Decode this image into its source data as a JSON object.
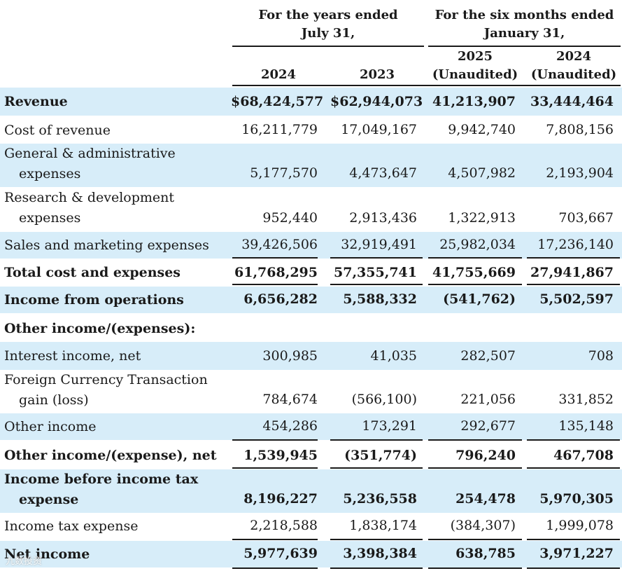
{
  "header": {
    "years_line1": "For the years ended",
    "years_line2": "July 31,",
    "six_line1": "For the six months ended",
    "six_line2": "January 31,",
    "col_2024": "2024",
    "col_2023": "2023",
    "col_2025_year": "2025",
    "col_2025_note": "(Unaudited)",
    "col_2024b_year": "2024",
    "col_2024b_note": "(Unaudited)"
  },
  "rows": [
    {
      "label": "Revenue",
      "v": [
        "$68,424,577",
        "$62,944,073",
        "41,213,907",
        "33,444,464"
      ]
    },
    {
      "label": "Cost of revenue",
      "v": [
        "16,211,779",
        "17,049,167",
        "9,942,740",
        "7,808,156"
      ]
    },
    {
      "label1": "General & administrative",
      "label2": "expenses",
      "v": [
        "5,177,570",
        "4,473,647",
        "4,507,982",
        "2,193,904"
      ]
    },
    {
      "label1": "Research & development",
      "label2": "expenses",
      "v": [
        "952,440",
        "2,913,436",
        "1,322,913",
        "703,667"
      ]
    },
    {
      "label": "Sales and marketing expenses",
      "v": [
        "39,426,506",
        "32,919,491",
        "25,982,034",
        "17,236,140"
      ]
    },
    {
      "label": "Total cost and expenses",
      "v": [
        "61,768,295",
        "57,355,741",
        "41,755,669",
        "27,941,867"
      ]
    },
    {
      "label": "Income from operations",
      "v": [
        "6,656,282",
        "5,588,332",
        "(541,762)",
        "5,502,597"
      ]
    },
    {
      "label": "Other income/(expenses):"
    },
    {
      "label": "Interest income, net",
      "v": [
        "300,985",
        "41,035",
        "282,507",
        "708"
      ]
    },
    {
      "label1": "Foreign Currency Transaction",
      "label2": "gain (loss)",
      "v": [
        "784,674",
        "(566,100)",
        "221,056",
        "331,852"
      ]
    },
    {
      "label": "Other income",
      "v": [
        "454,286",
        "173,291",
        "292,677",
        "135,148"
      ]
    },
    {
      "label": "Other income/(expense), net",
      "v": [
        "1,539,945",
        "(351,774)",
        "796,240",
        "467,708"
      ]
    },
    {
      "label1": "Income before income tax",
      "label2": "expense",
      "v": [
        "8,196,227",
        "5,236,558",
        "254,478",
        "5,970,305"
      ]
    },
    {
      "label": "Income tax expense",
      "v": [
        "2,218,588",
        "1,838,174",
        "(384,307)",
        "1,999,078"
      ]
    },
    {
      "label": "Net income",
      "v": [
        "5,977,639",
        "3,398,384",
        "638,785",
        "3,971,227"
      ]
    }
  ],
  "watermark": "九数投资"
}
